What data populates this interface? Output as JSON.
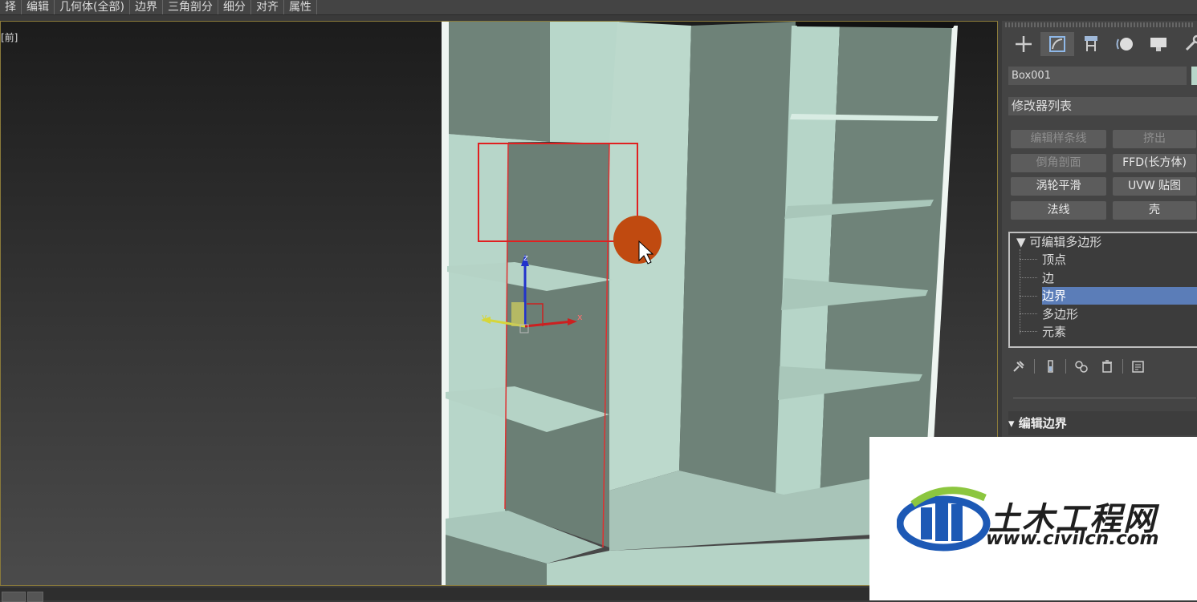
{
  "menubar": {
    "items": [
      "择",
      "编辑",
      "几何体(全部)",
      "边界",
      "三角剖分",
      "细分",
      "对齐",
      "属性"
    ]
  },
  "viewport": {
    "label": "[前]"
  },
  "panel": {
    "tabs": [
      "create-icon",
      "modify-icon",
      "hierarchy-icon",
      "motion-icon",
      "display-icon",
      "utilities-icon"
    ],
    "object_name": "Box001",
    "modifier_list_label": "修改器列表",
    "modifier_buttons": [
      {
        "label": "编辑样条线",
        "enabled": false
      },
      {
        "label": "挤出",
        "enabled": false
      },
      {
        "label": "倒角剖面",
        "enabled": false
      },
      {
        "label": "FFD(长方体)",
        "enabled": true
      },
      {
        "label": "涡轮平滑",
        "enabled": true
      },
      {
        "label": "UVW 贴图",
        "enabled": true
      },
      {
        "label": "法线",
        "enabled": true
      },
      {
        "label": "壳",
        "enabled": true
      }
    ],
    "stack": {
      "root": "▼ 可编辑多边形",
      "items": [
        "顶点",
        "边",
        "边界",
        "多边形",
        "元素"
      ],
      "selected_index": 2
    },
    "rollout_title": "▾ 编辑边界"
  },
  "gizmo": {
    "axis_x": "x",
    "axis_y": "y",
    "axis_z": "z"
  },
  "watermark": {
    "title": "土木工程网",
    "url": "www.civilcn.com"
  },
  "colors": {
    "selection_rect": "#e02020",
    "cursor_highlight": "#c04a10",
    "selected_item": "#5b7db8",
    "model_light": "#b7d6c9",
    "model_dark": "#6f8379"
  }
}
